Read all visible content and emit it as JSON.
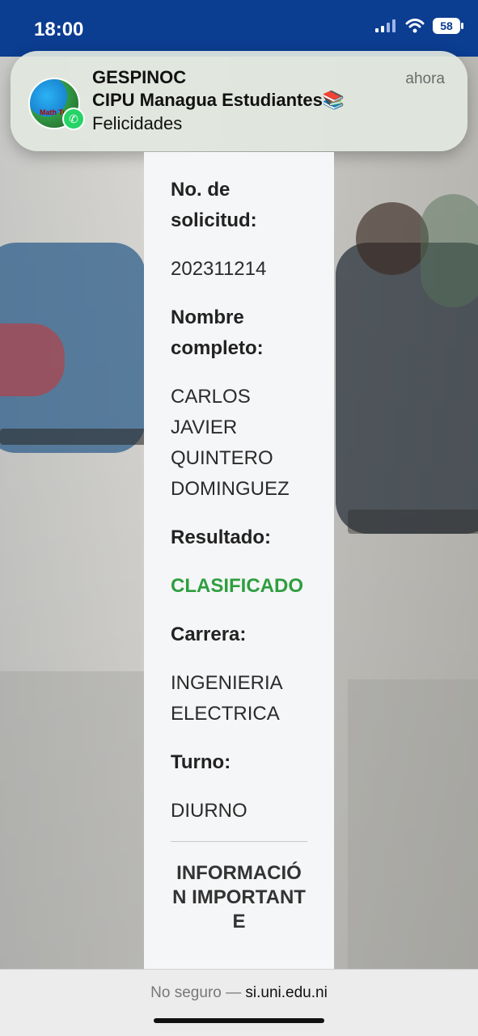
{
  "status_bar": {
    "time": "18:00",
    "battery": "58"
  },
  "notification": {
    "app_title": "GESPINOC",
    "group": "CIPU Managua Estudiantes📚",
    "message": "Felicidades",
    "time": "ahora",
    "avatar_text": "Math Tu"
  },
  "card": {
    "fields": [
      {
        "label": "No. de solicitud:",
        "value": "202311214"
      },
      {
        "label": "Nombre completo:",
        "value": "CARLOS JAVIER QUINTERO DOMINGUEZ"
      },
      {
        "label": "Resultado:",
        "value": "CLASIFICADO"
      },
      {
        "label": "Carrera:",
        "value": "INGENIERIA ELECTRICA"
      },
      {
        "label": "Turno:",
        "value": "DIURNO"
      }
    ],
    "important_heading": "INFORMACIÓN IMPORTANTE"
  },
  "browser": {
    "insecure_label": "No seguro —",
    "domain": "si.uni.edu.ni"
  },
  "colors": {
    "status_bar": "#0b3d91",
    "result_green": "#2e9e3f"
  }
}
